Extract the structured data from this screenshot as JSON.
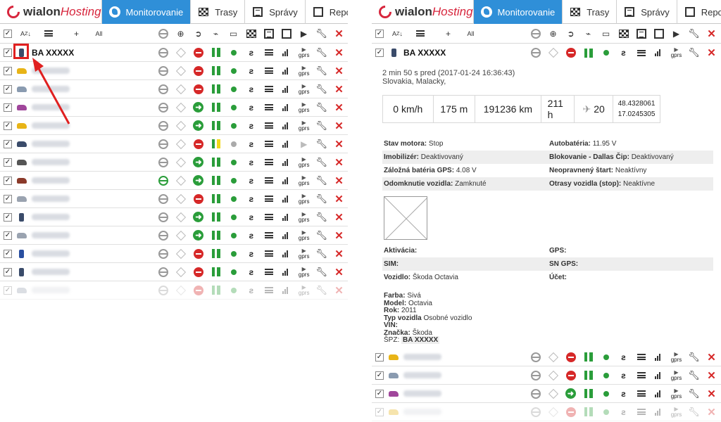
{
  "brand": {
    "logo_w": "wialon",
    "logo_h": "Hosting"
  },
  "tabs": [
    {
      "label": "Monitorovanie"
    },
    {
      "label": "Trasy"
    },
    {
      "label": "Správy"
    },
    {
      "label": "Reporty"
    }
  ],
  "toolbar": {
    "sort_az": "A",
    "sort_z": "Z",
    "add_all": "All"
  },
  "unit": {
    "name": "BA XXXXX"
  },
  "detail": {
    "time": "2 min 50 s pred (2017-01-24 16:36:43)",
    "location": "Slovakia, Malacky,",
    "speed": "0 km/h",
    "altitude": "175 m",
    "mileage": "191236 km",
    "engine_hours": "211 h",
    "satellites": "20",
    "lat": "48.4328061",
    "lon": "17.0245305",
    "params": [
      {
        "k1": "Stav motora:",
        "v1": "Stop",
        "k2": "Autobatéria:",
        "v2": "11.95 V"
      },
      {
        "k1": "Imobilizér:",
        "v1": "Deaktivovaný",
        "k2": "Blokovanie - Dallas Čip:",
        "v2": "Deaktivovaný"
      },
      {
        "k1": "Záložná batéria GPS:",
        "v1": "4.08 V",
        "k2": "Neopravnený štart:",
        "v2": "Neaktívny"
      },
      {
        "k1": "Odomknutie vozidla:",
        "v1": "Zamknuté",
        "k2": "Otrasy vozidla (stop):",
        "v2": "Neaktívne"
      }
    ],
    "info": [
      {
        "k1": "Aktivácia:",
        "v1": "",
        "k2": "GPS:",
        "v2": ""
      },
      {
        "k1": "SIM:",
        "v1": "",
        "k2": "SN GPS:",
        "v2": ""
      },
      {
        "k1": "Vozidlo:",
        "v1": "Škoda Octavia",
        "k2": "Účet:",
        "v2": ""
      }
    ],
    "props": {
      "farba_k": "Farba:",
      "farba_v": "Sivá",
      "model_k": "Model:",
      "model_v": "Octavia",
      "rok_k": "Rok:",
      "rok_v": "2011",
      "typ_k": "Typ vozidla",
      "typ_v": "Osobné vozidlo",
      "vin_k": "VIN:",
      "znacka_k": "Značka:",
      "znacka_v": "Škoda",
      "spz_k": "ŠPZ:",
      "spz_v": "BA XXXXX"
    }
  },
  "colors": {
    "accent": "#2f8fd8",
    "danger": "#d62828",
    "ok": "#2a9d3a",
    "logo": "#d7263d"
  }
}
